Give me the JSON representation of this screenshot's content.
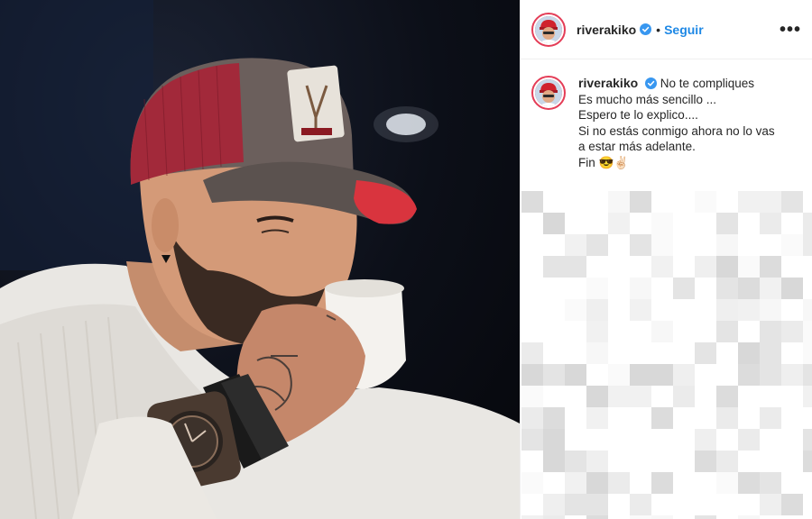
{
  "post": {
    "username": "riverakiko",
    "follow_label": "Seguir",
    "separator": "•",
    "more_label": "•••"
  },
  "caption": {
    "username": "riverakiko",
    "first_line": "No te compliques",
    "lines": [
      "Es mucho más sencillo ...",
      "Espero te lo explico....",
      "Si no estás conmigo ahora no lo vas",
      "a estar más adelante.",
      "Fin 😎✌🏻"
    ]
  },
  "colors": {
    "follow_blue": "#1e88e5",
    "story_ring": "#e43d57",
    "verified_blue": "#3897f0"
  },
  "icons": {
    "verified": "verified-badge-icon",
    "more": "more-options-icon"
  }
}
